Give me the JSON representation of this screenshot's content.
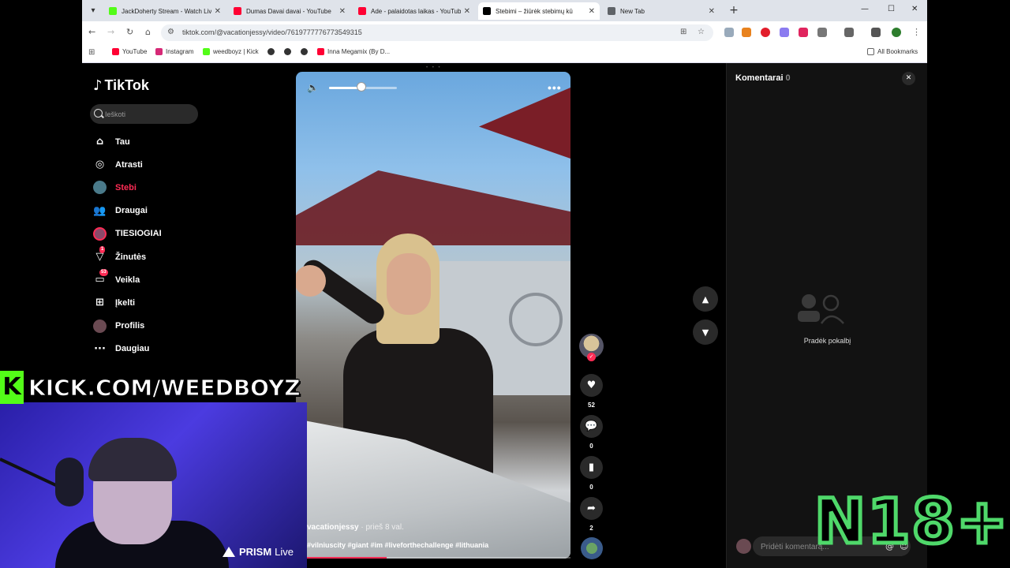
{
  "browser": {
    "tabs": [
      {
        "title": "JackDoherty Stream - Watch Liv",
        "favicon_color": "#53fc18",
        "active": false
      },
      {
        "title": "Dumas Davai davai - YouTube",
        "favicon_color": "#ff0033",
        "active": false
      },
      {
        "title": "Ade - palaidotas laikas - YouTub",
        "favicon_color": "#ff0033",
        "active": false
      },
      {
        "title": "Stebimi – žiūrėk stebimų kū",
        "favicon_color": "#000000",
        "active": true
      },
      {
        "title": "New Tab",
        "favicon_color": "#5f6368",
        "active": false
      }
    ],
    "new_tab_glyph": "+",
    "url": "tiktok.com/@vacationjessy/video/7619777776773549315",
    "bookmarks": [
      {
        "label": "YouTube",
        "color": "#ff0033"
      },
      {
        "label": "Instagram",
        "color": "#d62976"
      },
      {
        "label": "weedboyz | Kick",
        "color": "#53fc18"
      },
      {
        "label": "",
        "color": "#333333"
      },
      {
        "label": "",
        "color": "#333333"
      },
      {
        "label": "",
        "color": "#333333"
      },
      {
        "label": "Inna Megamix (By D...",
        "color": "#ff0033"
      }
    ],
    "all_bookmarks": "All Bookmarks"
  },
  "tiktok": {
    "logo_text": "TikTok",
    "search_placeholder": "Ieškoti",
    "nav": [
      {
        "label": "Tau",
        "icon": "home-icon",
        "active": false,
        "badge": ""
      },
      {
        "label": "Atrasti",
        "icon": "compass-icon",
        "active": false,
        "badge": ""
      },
      {
        "label": "Stebi",
        "icon": "live-avatar-icon",
        "active": true,
        "badge": ""
      },
      {
        "label": "Draugai",
        "icon": "friends-icon",
        "active": false,
        "badge": ""
      },
      {
        "label": "TIESIOGIAI",
        "icon": "live-icon",
        "active": false,
        "badge": ""
      },
      {
        "label": "Žinutės",
        "icon": "send-icon",
        "active": false,
        "badge": "1"
      },
      {
        "label": "Veikla",
        "icon": "inbox-icon",
        "active": false,
        "badge": "53"
      },
      {
        "label": "Įkelti",
        "icon": "upload-icon",
        "active": false,
        "badge": ""
      },
      {
        "label": "Profilis",
        "icon": "profile-avatar-icon",
        "active": false,
        "badge": ""
      },
      {
        "label": "Daugiau",
        "icon": "more-icon",
        "active": false,
        "badge": ""
      }
    ],
    "video": {
      "author": "vacationjessy",
      "posted": " · prieš 8 val.",
      "hashtags": "#vilniuscity #giant #im #liveforthechallenge #lithuania",
      "volume_fraction": 0.48,
      "progress_fraction": 0.33,
      "more_glyph": "•••"
    },
    "actions": {
      "likes": "52",
      "comments": "0",
      "saves": "0",
      "shares": "2"
    },
    "comments_panel": {
      "title": "Komentarai",
      "count": "0",
      "empty_text": "Pradėk pokalbį",
      "input_placeholder": "Pridėti komentarą...",
      "at_glyph": "@",
      "emoji_glyph": "☺"
    }
  },
  "overlay": {
    "kick_logo": "K",
    "kick_text": "KICK.COM/WEEDBOYZ",
    "prism_brand": "PRISM",
    "prism_suffix": "Live",
    "rating": "N18+"
  }
}
